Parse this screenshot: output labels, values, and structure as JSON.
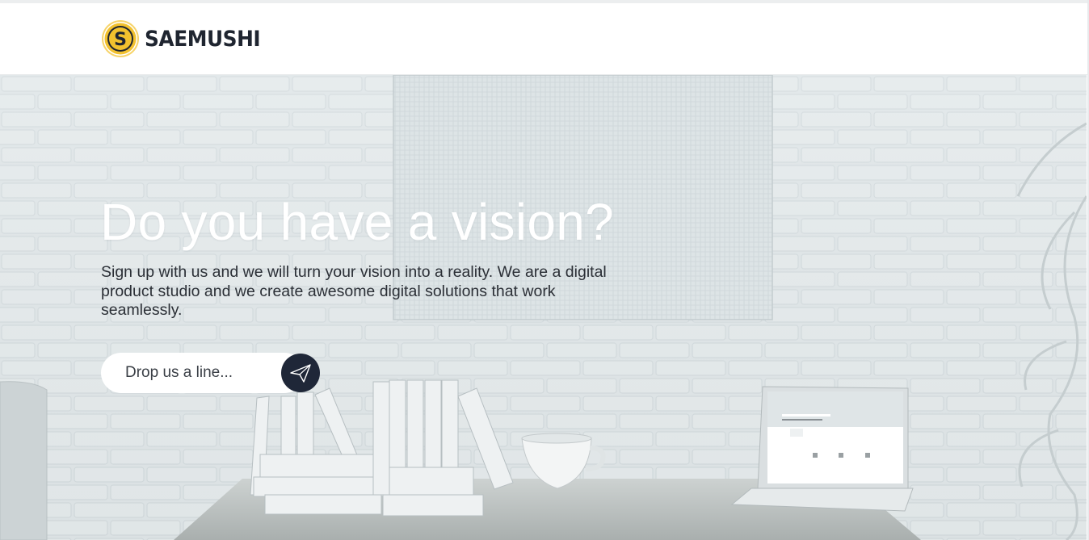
{
  "brand": {
    "name": "SAEMUSHI",
    "logo_letter": "S",
    "icon": "saemushi-logo-icon"
  },
  "hero": {
    "title": "Do you have a vision?",
    "subtitle": "Sign up with us and we will turn your vision into a reality. We are a digital product studio and we create awesome digital solutions that work seamlessly."
  },
  "cta": {
    "placeholder": "Drop us a line...",
    "button_icon": "paper-plane-icon"
  },
  "colors": {
    "accent": "#f2c12e",
    "dark": "#1f2738",
    "brand_text": "#1f2530",
    "subtitle_text": "#2b2f36"
  }
}
